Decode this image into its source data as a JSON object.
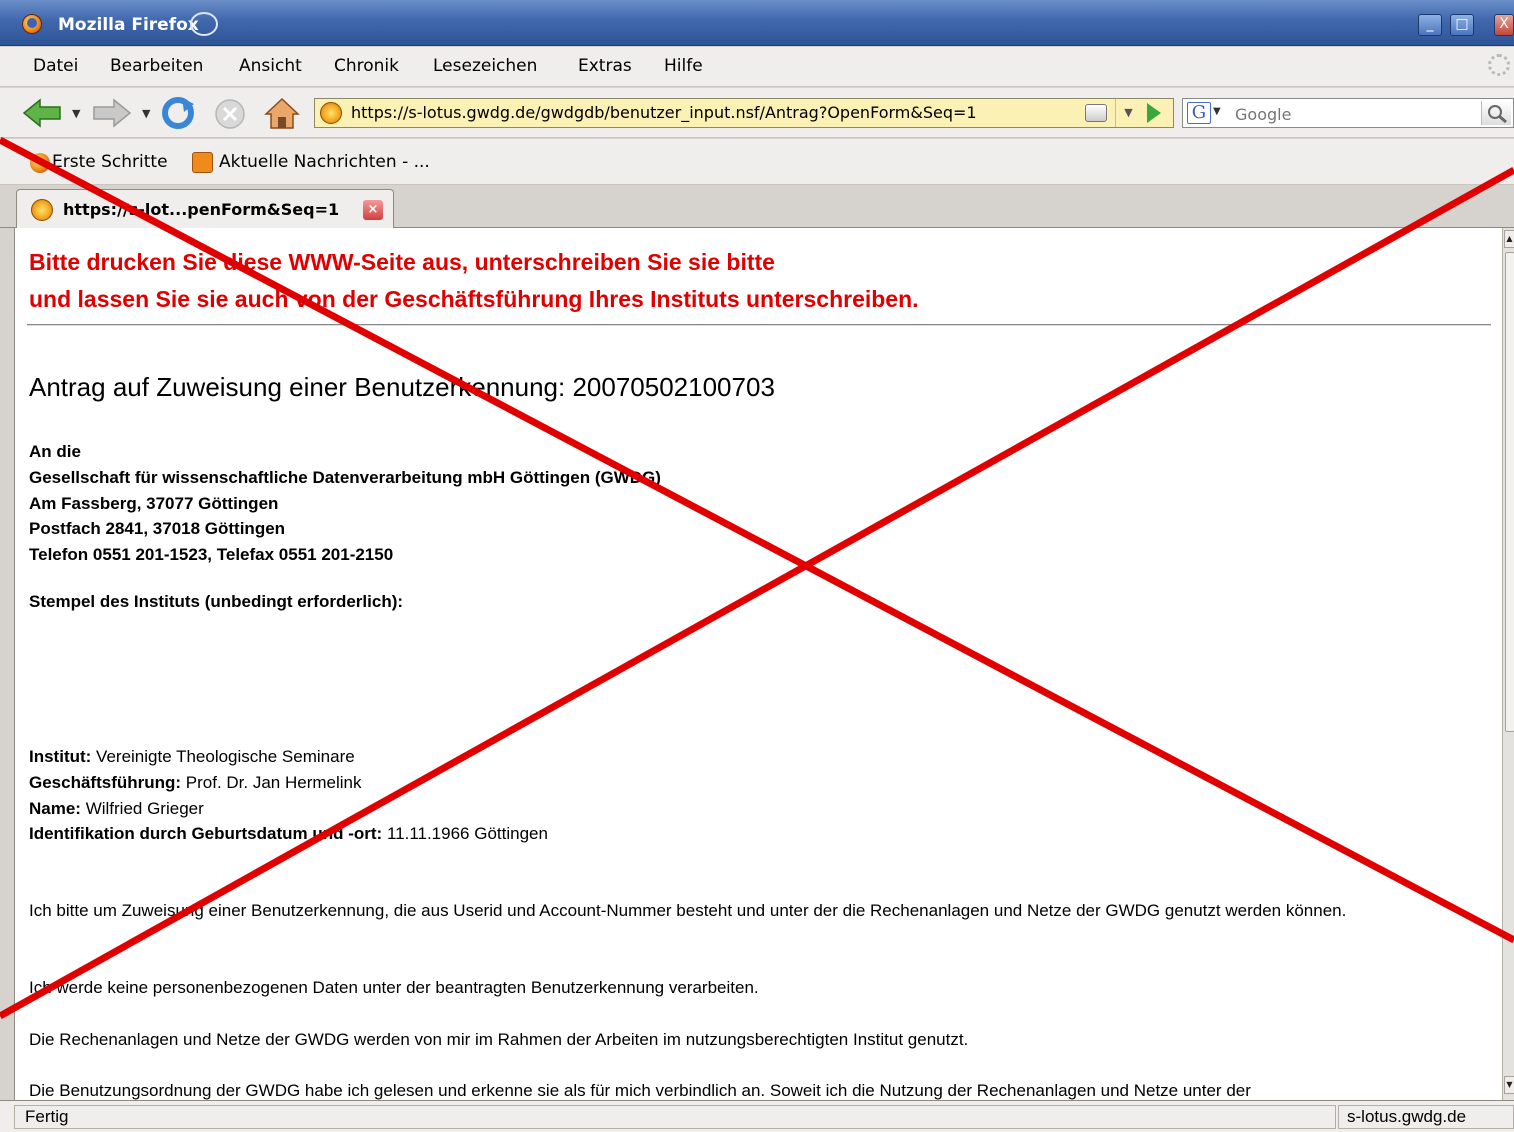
{
  "window": {
    "title": "Mozilla Firefox",
    "controls": {
      "minimize": "_",
      "maximize": "□",
      "close": "X"
    }
  },
  "menu": [
    "Datei",
    "Bearbeiten",
    "Ansicht",
    "Chronik",
    "Lesezeichen",
    "Extras",
    "Hilfe"
  ],
  "navigation": {
    "url": "https://s-lotus.gwdg.de/gwdgdb/benutzer_input.nsf/Antrag?OpenForm&Seq=1",
    "search_placeholder": "Google",
    "search_engine_letter": "G",
    "icons": [
      "back-icon",
      "forward-icon",
      "reload-icon",
      "stop-icon",
      "home-icon",
      "go-icon",
      "search-icon"
    ]
  },
  "bookmarks": [
    "Erste Schritte",
    "Aktuelle Nachrichten - ..."
  ],
  "tab": {
    "label": "https://s-lot...penForm&Seq=1"
  },
  "page": {
    "notice_line1": "Bitte drucken Sie diese WWW-Seite aus, unterschreiben Sie sie bitte",
    "notice_line2": "und lassen Sie sie auch von der Geschäftsführung Ihres Instituts unterschreiben.",
    "heading": "Antrag auf Zuweisung einer Benutzerkennung: 20070502100703",
    "address": [
      "An die",
      "Gesellschaft für wissenschaftliche Datenverarbeitung mbH Göttingen (GWDG)",
      "Am Fassberg, 37077 Göttingen",
      "Postfach 2841, 37018 Göttingen",
      "Telefon 0551 201-1523, Telefax 0551 201-2150"
    ],
    "stamp_label": "Stempel des Instituts (unbedingt erforderlich):",
    "fields": [
      {
        "label": "Institut:",
        "value": " Vereinigte Theologische Seminare"
      },
      {
        "label": "Geschäftsführung:",
        "value": " Prof. Dr. Jan Hermelink"
      },
      {
        "label": "Name:",
        "value": " Wilfried Grieger"
      },
      {
        "label": "Identifikation durch Geburtsdatum und -ort:",
        "value": " 11.11.1966 Göttingen"
      }
    ],
    "paragraph1": "Ich bitte um Zuweisung einer Benutzerkennung, die aus Userid und Account-Nummer besteht und unter der die Rechenanlagen und Netze der GWDG genutzt werden können.",
    "paragraph2": "Ich werde keine personenbezogenen Daten unter der beantragten Benutzerkennung verarbeiten.",
    "paragraph3": "Die Rechenanlagen und Netze der GWDG werden von mir im Rahmen der Arbeiten im nutzungsberechtigten Institut genutzt.",
    "paragraph4": "Die Benutzungsordnung der GWDG habe ich gelesen und erkenne sie als für mich verbindlich an. Soweit ich die Nutzung der Rechenanlagen und Netze unter der"
  },
  "status": {
    "text": "Fertig",
    "site": "s-lotus.gwdg.de"
  },
  "colors": {
    "notice": "#e00000",
    "overlay_x": "#e00000",
    "titlebar": "#4068ad"
  }
}
